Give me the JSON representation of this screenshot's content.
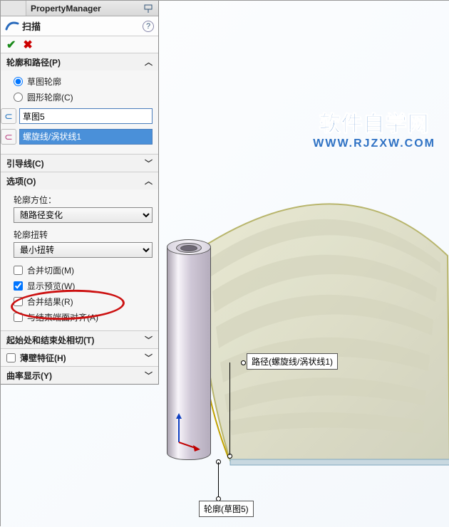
{
  "header": {
    "title": "PropertyManager"
  },
  "feature": {
    "title": "扫描"
  },
  "sections": {
    "profile_path": {
      "title": "轮廓和路径(P)",
      "radio_sketch": "草图轮廓",
      "radio_circle": "圆形轮廓(C)",
      "profile_value": "草图5",
      "path_value": "螺旋线/涡状线1"
    },
    "guide": {
      "title": "引导线(C)"
    },
    "options": {
      "title": "选项(O)",
      "orient_label": "轮廓方位：",
      "orient_value": "随路径变化",
      "twist_label": "轮廓扭转",
      "twist_value": "最小扭转",
      "merge_tangent": "合并切面(M)",
      "show_preview": "显示预览(W)",
      "merge_result": "合并结果(R)",
      "align_end": "与结束端面对齐(A)"
    },
    "start_end": {
      "title": "起始处和结束处相切(T)"
    },
    "thin": {
      "title": "薄壁特征(H)"
    },
    "curvature": {
      "title": "曲率显示(Y)"
    }
  },
  "callouts": {
    "path": "路径(螺旋线/涡状线1)",
    "profile": "轮廓(草图5)"
  },
  "watermark": {
    "line1": "软件自学网",
    "line2": "WWW.RJZXW.COM"
  }
}
